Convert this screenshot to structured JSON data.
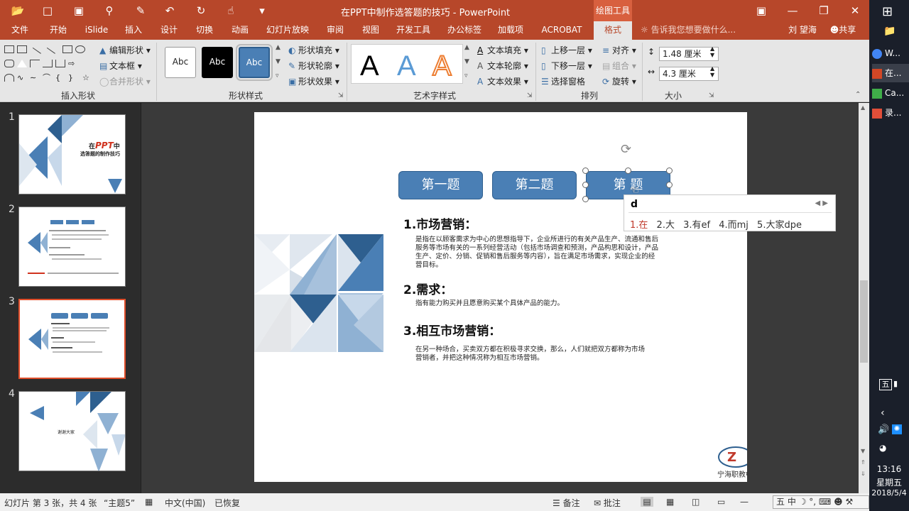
{
  "titlebar": {
    "doc_title": "在PPT中制作选答题的技巧 - PowerPoint",
    "context_tab": "绘图工具"
  },
  "tabs": [
    "文件",
    "开始",
    "iSlide",
    "插入",
    "设计",
    "切换",
    "动画",
    "幻灯片放映",
    "审阅",
    "视图",
    "开发工具",
    "办公标签",
    "加载项",
    "ACROBAT",
    "格式"
  ],
  "active_tab": "格式",
  "tell_me": "告诉我您想要做什么...",
  "user": "刘 望海",
  "share": "共享",
  "ribbon": {
    "edit_shape": "编辑形状",
    "text_box": "文本框",
    "merge_shapes": "合并形状",
    "group_insert_shapes": "插入形状",
    "style_sample": "Abc",
    "shape_fill": "形状填充",
    "shape_outline": "形状轮廓",
    "shape_effect": "形状效果",
    "group_shape_styles": "形状样式",
    "wordart_letter": "A",
    "text_fill": "文本填充",
    "text_outline": "文本轮廓",
    "text_effect": "文本效果",
    "group_wordart": "艺术字样式",
    "bring_forward": "上移一层",
    "send_backward": "下移一层",
    "selection_pane": "选择窗格",
    "align": "对齐",
    "group": "组合",
    "rotate": "旋转",
    "group_arrange": "排列",
    "height": "1.48 厘米",
    "width": "4.3 厘米",
    "group_size": "大小"
  },
  "thumbnails": [
    {
      "num": "1",
      "title_pre": "在",
      "title_ppt": "PPT",
      "title_post": "中",
      "subtitle": "选答题的制作技巧"
    },
    {
      "num": "2"
    },
    {
      "num": "3"
    },
    {
      "num": "4",
      "text": "谢谢大家"
    }
  ],
  "slide": {
    "buttons": [
      "第一题",
      "第二题",
      "第 题"
    ],
    "h1": "1.市场营销：",
    "p1": "是指在以顾客需求为中心的思想指导下，企业所进行的有关产品生产、流通和售后服务等市场有关的一系列经营活动（包括市场调查和预测，产品构思和设计，产品生产、定价、分销、促销和售后服务等内容），旨在满足市场需求，实现企业的经营目标。",
    "h2": "2.需求：",
    "p2": "指有能力购买并且愿意购买某个具体产品的能力。",
    "h3": "3.相互市场营销：",
    "p3": "在另一种场合，买卖双方都在积极寻求交换，那么，人们就把双方都称为市场营销者，并把这种情况称为相互市场营销。",
    "logo_text": "宁海职教中心"
  },
  "ime": {
    "input": "d",
    "candidates": [
      "1.在",
      "2.大",
      "3.有ef",
      "4.而mj",
      "5.大家dpe"
    ]
  },
  "status": {
    "slide_info": "幻灯片 第 3 张，共 4 张",
    "theme": "“主题5”",
    "lang": "中文(中国)",
    "recovered": "已恢复",
    "notes": "备注",
    "comments": "批注"
  },
  "taskbar": {
    "items": [
      "W...",
      "在...",
      "Ca...",
      "录..."
    ],
    "ime_mode": "五",
    "time": "13:16",
    "weekday": "星期五",
    "date": "2018/5/4"
  },
  "colors": {
    "accent": "#b7472a",
    "button_blue": "#4a7fb5",
    "slide_dark_blue": "#2e5f8f",
    "slide_light_blue": "#8fb1d3"
  }
}
